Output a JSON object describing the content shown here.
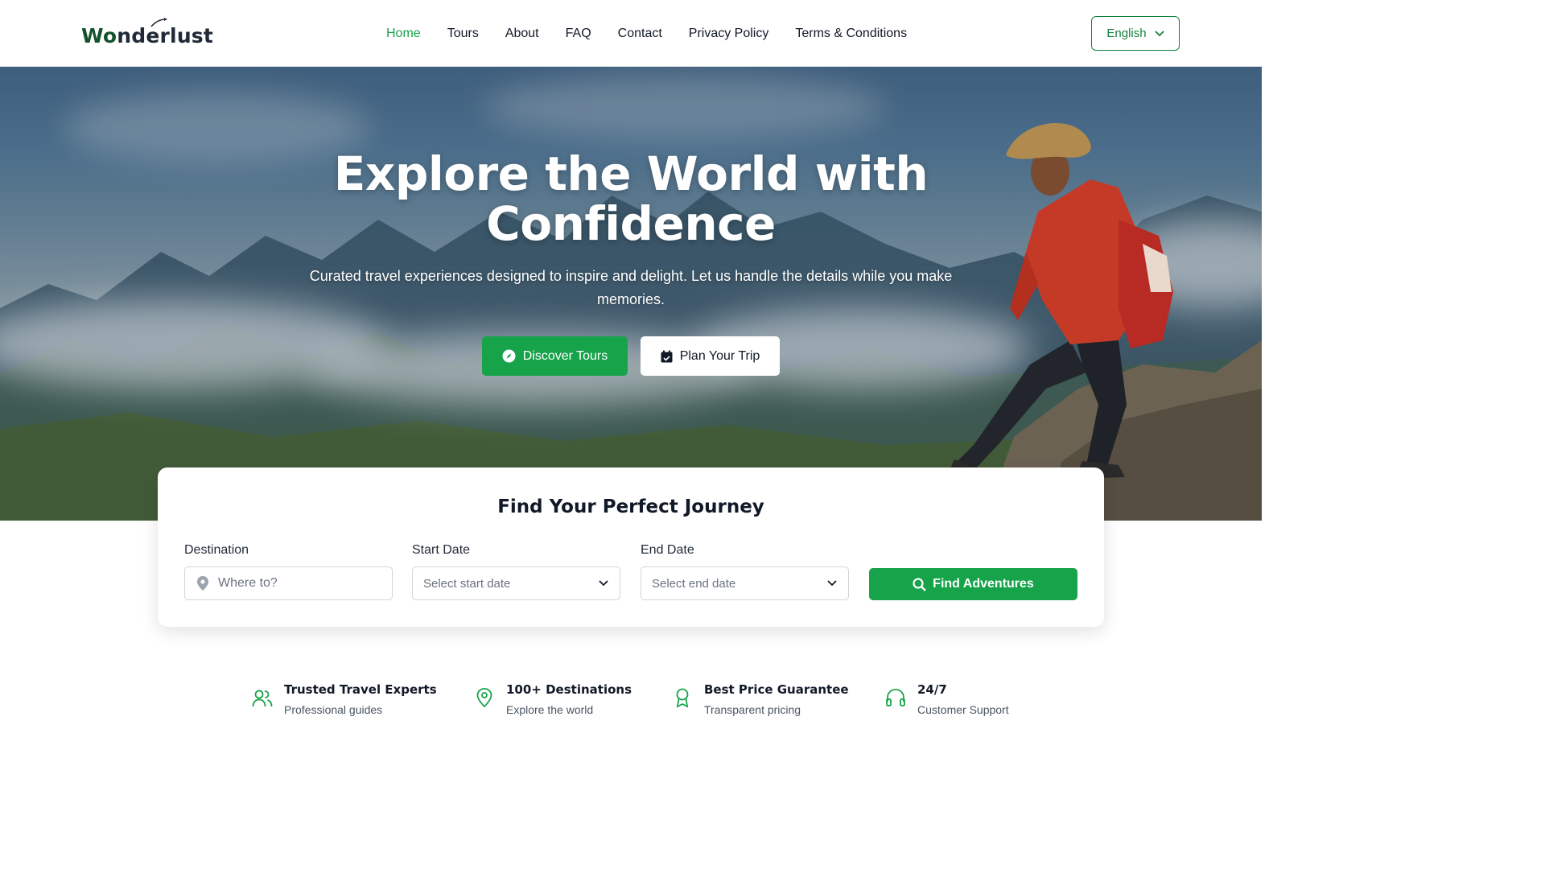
{
  "brand": {
    "logo_part1": "Wo",
    "logo_part2": "nderlust",
    "color_primary": "#16a34a",
    "color_logo": "#14532d"
  },
  "nav": {
    "items": [
      {
        "label": "Home",
        "active": true
      },
      {
        "label": "Tours",
        "active": false
      },
      {
        "label": "About",
        "active": false
      },
      {
        "label": "FAQ",
        "active": false
      },
      {
        "label": "Contact",
        "active": false
      },
      {
        "label": "Privacy Policy",
        "active": false
      },
      {
        "label": "Terms & Conditions",
        "active": false
      }
    ],
    "language": "English"
  },
  "hero": {
    "title_line1": "Explore the World with",
    "title_line2": "Confidence",
    "subtitle": "Curated travel experiences designed to inspire and delight. Let us handle the details while you make memories.",
    "primary_cta": "Discover Tours",
    "secondary_cta": "Plan Your Trip",
    "primary_icon": "compass-icon",
    "secondary_icon": "calendar-check-icon"
  },
  "search": {
    "title": "Find Your Perfect Journey",
    "destination_label": "Destination",
    "destination_placeholder": "Where to?",
    "start_label": "Start Date",
    "start_placeholder": "Select start date",
    "end_label": "End Date",
    "end_placeholder": "Select end date",
    "submit_label": "Find Adventures"
  },
  "features": [
    {
      "title": "Trusted Travel Experts",
      "desc": "Professional guides",
      "icon": "users-icon"
    },
    {
      "title": "100+ Destinations",
      "desc": "Explore the world",
      "icon": "map-pin-icon"
    },
    {
      "title": "Best Price Guarantee",
      "desc": "Transparent pricing",
      "icon": "award-icon"
    },
    {
      "title": "24/7",
      "desc": "Customer Support",
      "icon": "headphones-icon"
    }
  ]
}
